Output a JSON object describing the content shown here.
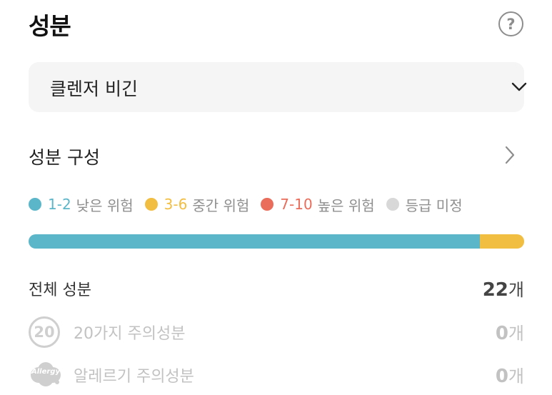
{
  "header": {
    "title": "성분",
    "help_glyph": "?"
  },
  "product_select": {
    "value": "클렌저 비긴",
    "icon": "chevron-down-icon"
  },
  "composition": {
    "title": "성분 구성",
    "icon": "chevron-right-icon"
  },
  "legend": [
    {
      "range": "1-2",
      "name": "낮은 위험",
      "color": "#5bb6c9"
    },
    {
      "range": "3-6",
      "name": "중간 위험",
      "color": "#f2be42"
    },
    {
      "range": "7-10",
      "name": "높은 위험",
      "color": "#ea6c5a"
    },
    {
      "range": "",
      "name": "등급 미정",
      "color": "#d8d8d8"
    }
  ],
  "risk_distribution": [
    {
      "level": "1-2",
      "fraction": 0.91,
      "color": "#5bb6c9"
    },
    {
      "level": "3-6",
      "fraction": 0.09,
      "color": "#f2be42"
    }
  ],
  "stats": {
    "total": {
      "label": "전체 성분",
      "count": "22",
      "unit": "개"
    },
    "caution20": {
      "label": "20가지 주의성분",
      "count": "0",
      "unit": "개",
      "icon_text": "20"
    },
    "allergy": {
      "label": "알레르기 주의성분",
      "count": "0",
      "unit": "개",
      "icon_text": "Allergy"
    }
  }
}
